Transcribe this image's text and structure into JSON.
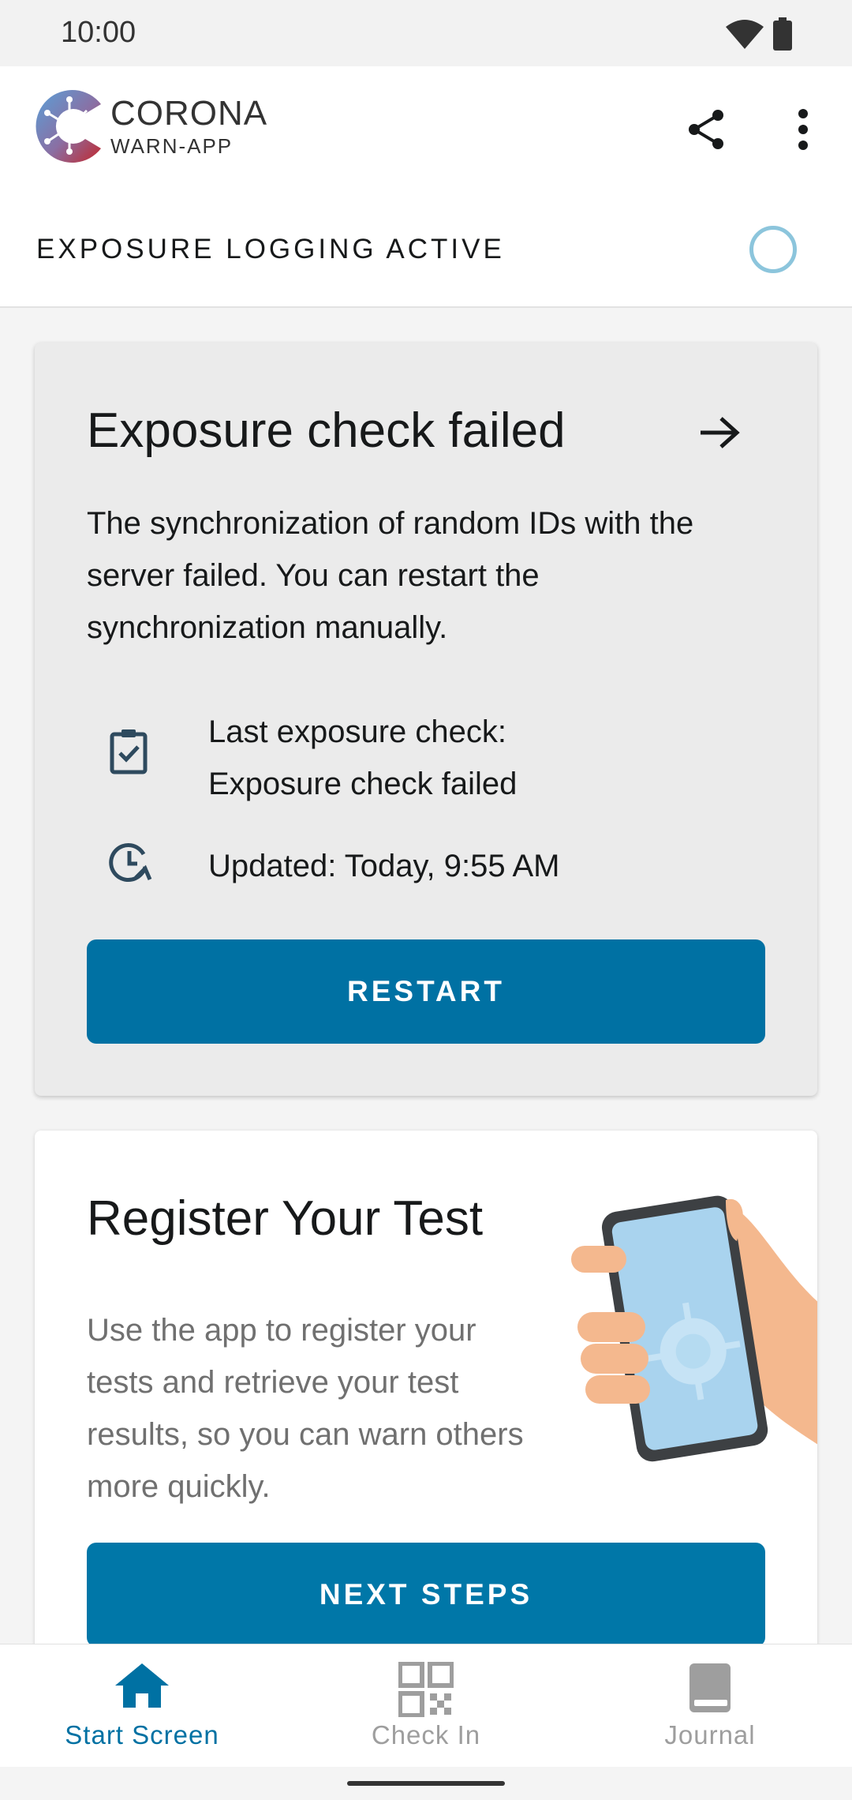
{
  "status_bar": {
    "time": "10:00"
  },
  "app_bar": {
    "logo_line1": "CORONA",
    "logo_line2": "WARN-APP",
    "status_label": "EXPOSURE LOGGING ACTIVE"
  },
  "risk_card": {
    "title": "Exposure check failed",
    "body": "The synchronization of random IDs with the server failed. You can restart the synchronization manually.",
    "row1_line1": "Last exposure check:",
    "row1_line2": "Exposure check failed",
    "row2": "Updated: Today, 9:55 AM",
    "button_label": "RESTART"
  },
  "test_card": {
    "title": "Register Your Test",
    "body": "Use the app to register your tests and retrieve your test results, so you can warn others more quickly.",
    "button_label": "NEXT STEPS"
  },
  "bottom_nav": {
    "items": [
      {
        "label": "Start Screen",
        "icon": "home-icon",
        "active": true
      },
      {
        "label": "Check In",
        "icon": "qr-code-icon",
        "active": false
      },
      {
        "label": "Journal",
        "icon": "book-icon",
        "active": false
      }
    ]
  },
  "colors": {
    "primary": "#0071a3",
    "status_ring": "#8cc5dc",
    "logo_blue": "#5aa0d8",
    "logo_red": "#c2272d"
  }
}
